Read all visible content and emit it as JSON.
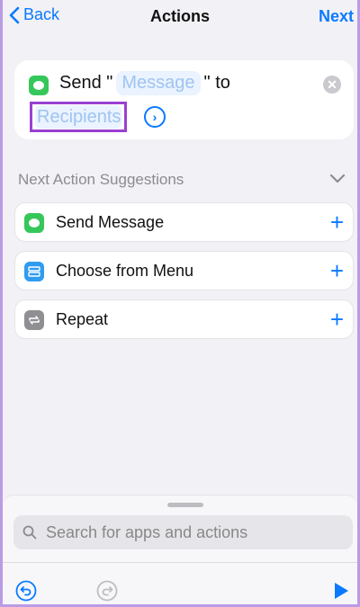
{
  "nav": {
    "back_label": "Back",
    "title": "Actions",
    "next_label": "Next"
  },
  "action": {
    "app_icon": "messages-icon",
    "prefix": "Send \"",
    "message_token": "Message",
    "suffix": "\" to",
    "recipients_token": "Recipients"
  },
  "suggestions": {
    "header": "Next Action Suggestions",
    "items": [
      {
        "label": "Send Message",
        "icon": "messages-icon",
        "color": "#35c759"
      },
      {
        "label": "Choose from Menu",
        "icon": "menu-icon",
        "color": "#2f9cf0"
      },
      {
        "label": "Repeat",
        "icon": "repeat-icon",
        "color": "#8e8e93"
      }
    ]
  },
  "search": {
    "placeholder": "Search for apps and actions"
  },
  "colors": {
    "accent": "#0a7aff",
    "highlight_box": "#9a40d2",
    "token_bg": "#eaf3ff"
  }
}
